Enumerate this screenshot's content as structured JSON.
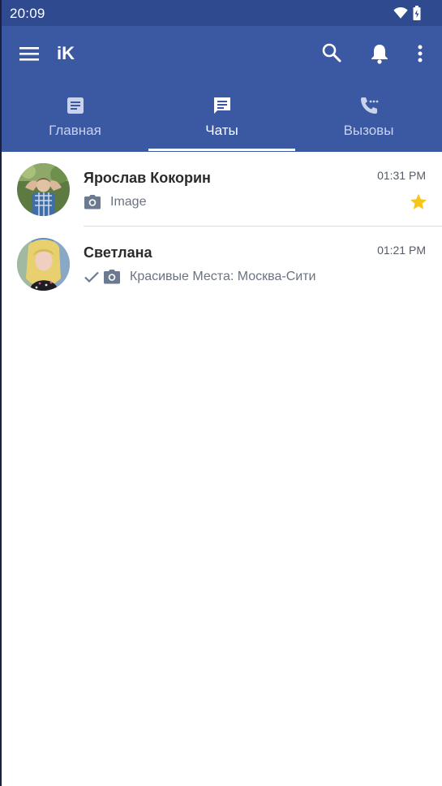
{
  "status_bar": {
    "time": "20:09",
    "icons": [
      "wifi-icon",
      "battery-icon"
    ]
  },
  "app_bar": {
    "title": "iK",
    "actions": [
      "search-icon",
      "bell-icon",
      "more-vert-icon"
    ]
  },
  "tabs": [
    {
      "label": "Главная",
      "icon": "document-icon",
      "active": false
    },
    {
      "label": "Чаты",
      "icon": "chat-icon",
      "active": true
    },
    {
      "label": "Вызовы",
      "icon": "phone-icon",
      "active": false
    }
  ],
  "chats": [
    {
      "name": "Ярослав Кокорин",
      "time": "01:31 PM",
      "preview": "Image",
      "preview_icon": "camera-icon",
      "starred": true,
      "sent_check": false
    },
    {
      "name": "Светлана",
      "time": "01:21 PM",
      "preview": "Красивые Места: Москва-Сити",
      "preview_icon": "camera-icon",
      "starred": false,
      "sent_check": true
    }
  ],
  "colors": {
    "app_bar": "#3b58a2",
    "status_bar": "#2f4a8e",
    "star": "#f5c518"
  }
}
